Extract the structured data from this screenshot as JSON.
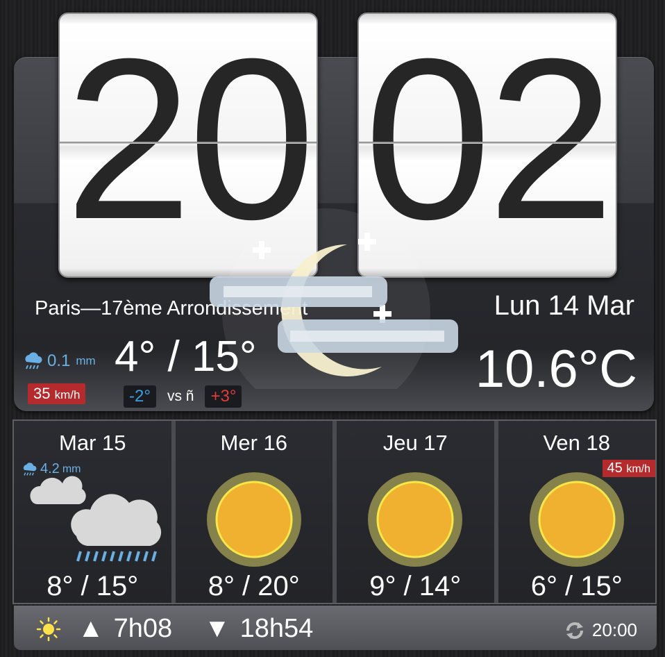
{
  "clock": {
    "hour": "20",
    "minute": "02"
  },
  "location": {
    "name": "Paris—17ème Arrondissement"
  },
  "date": {
    "label": "Lun 14 Mar"
  },
  "today": {
    "rain_value": "0.1",
    "rain_unit": "mm",
    "wind_value": "35",
    "wind_unit": "km/h",
    "temp_range": "4° / 15°",
    "compare_low": "-2°",
    "compare_vs": "vs ñ",
    "compare_high": "+3°",
    "current_temp": "10.6°C",
    "icon": "moon-cloud-icon"
  },
  "forecast": [
    {
      "day": "Mar 15",
      "temps": "8° / 15°",
      "icon": "rain-cloud-icon",
      "rain_value": "4.2",
      "rain_unit": "mm"
    },
    {
      "day": "Mer 16",
      "temps": "8° / 20°",
      "icon": "sun-icon"
    },
    {
      "day": "Jeu 17",
      "temps": "9° / 14°",
      "icon": "sun-icon"
    },
    {
      "day": "Ven 18",
      "temps": "6° / 15°",
      "icon": "sun-icon",
      "wind_value": "45",
      "wind_unit": "km/h"
    }
  ],
  "footer": {
    "sunrise": "7h08",
    "sunset": "18h54",
    "updated": "20:00",
    "sunrise_symbol": "▲",
    "sunset_symbol": "▼"
  },
  "colors": {
    "rain_blue": "#6ab0e4",
    "wind_red": "#b52a2c",
    "cold_blue": "#3aa0e0",
    "warm_red": "#e23b3b",
    "sun_orange": "#f0b030"
  }
}
